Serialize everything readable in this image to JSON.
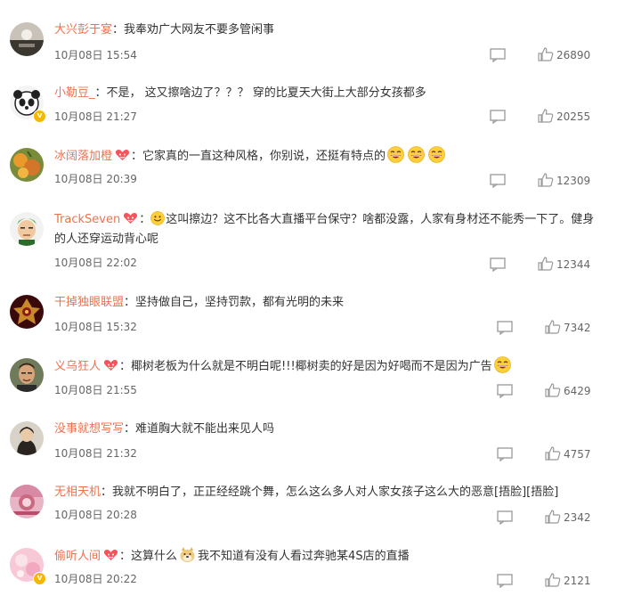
{
  "comments": [
    {
      "user": "大兴彭于宴",
      "text": "我奉劝广大网友不要多管闲事",
      "time": "10月08日 15:54",
      "likes": "26890",
      "fan_badge": false,
      "verified": false
    },
    {
      "user": "小勒豆_",
      "text": "不是， 这又擦啥边了？？？ 穿的比夏天大街上大部分女孩都多",
      "time": "10月08日 21:27",
      "likes": "20255",
      "fan_badge": false,
      "verified": true
    },
    {
      "user": "冰阔落加橙",
      "text": "它家真的一直这种风格，你别说，还挺有特点的",
      "time": "10月08日 20:39",
      "likes": "12309",
      "fan_badge": true,
      "verified": false
    },
    {
      "user": "TrackSeven",
      "text": "这叫擦边？这不比各大直播平台保守？啥都没露，人家有身材还不能秀一下了。健身的人还穿运动背心呢",
      "time": "10月08日 22:02",
      "likes": "12344",
      "fan_badge": true,
      "verified": false
    },
    {
      "user": "干掉独眼联盟",
      "text": "坚持做自己，坚持罚款，都有光明的未来",
      "time": "10月08日 15:32",
      "likes": "7342",
      "fan_badge": false,
      "verified": false
    },
    {
      "user": "义乌狂人",
      "text": "椰树老板为什么就是不明白呢!!!椰树卖的好是因为好喝而不是因为广告",
      "time": "10月08日 21:55",
      "likes": "6429",
      "fan_badge": true,
      "verified": false
    },
    {
      "user": "没事就想写写",
      "text": "难道胸大就不能出来见人吗",
      "time": "10月08日 21:32",
      "likes": "4757",
      "fan_badge": false,
      "verified": false
    },
    {
      "user": "无相天机",
      "text": "我就不明白了，正正经经跳个舞，怎么这么多人对人家女孩子这么大的恶意[捂脸][捂脸]",
      "time": "10月08日 20:28",
      "likes": "2342",
      "fan_badge": false,
      "verified": false
    },
    {
      "user": "偷听人间",
      "text_before": "这算什么",
      "text_after": "我不知道有没有人看过奔驰某4S店的直播",
      "time": "10月08日 20:22",
      "likes": "2121",
      "fan_badge": true,
      "verified": true
    }
  ],
  "separator": "：",
  "colors": {
    "username": "#eb7350",
    "text": "#333333",
    "meta": "#666666",
    "icon": "#999999"
  }
}
